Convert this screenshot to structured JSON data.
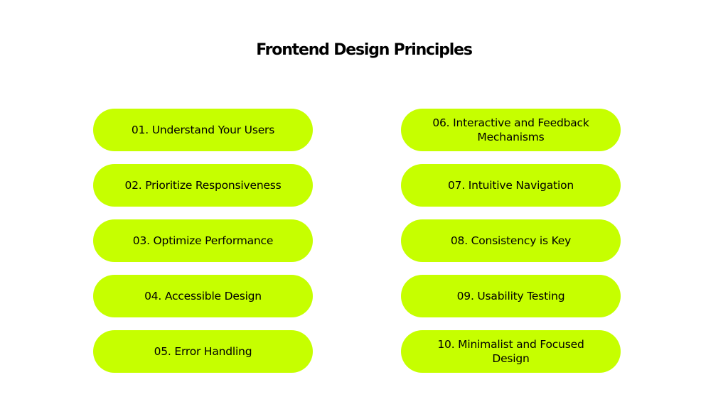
{
  "title": "Frontend Design Principles",
  "colors": {
    "pill_fill": "#C6FF00",
    "text": "#000000",
    "background": "#FFFFFF"
  },
  "left_column": [
    {
      "label": "01. Understand Your Users"
    },
    {
      "label": "02. Prioritize Responsiveness"
    },
    {
      "label": "03. Optimize Performance"
    },
    {
      "label": "04. Accessible Design"
    },
    {
      "label": "05. Error Handling"
    }
  ],
  "right_column": [
    {
      "label": "06. Interactive and Feedback Mechanisms"
    },
    {
      "label": "07. Intuitive Navigation"
    },
    {
      "label": "08. Consistency is Key"
    },
    {
      "label": "09. Usability Testing"
    },
    {
      "label": "10. Minimalist and Focused Design"
    }
  ]
}
